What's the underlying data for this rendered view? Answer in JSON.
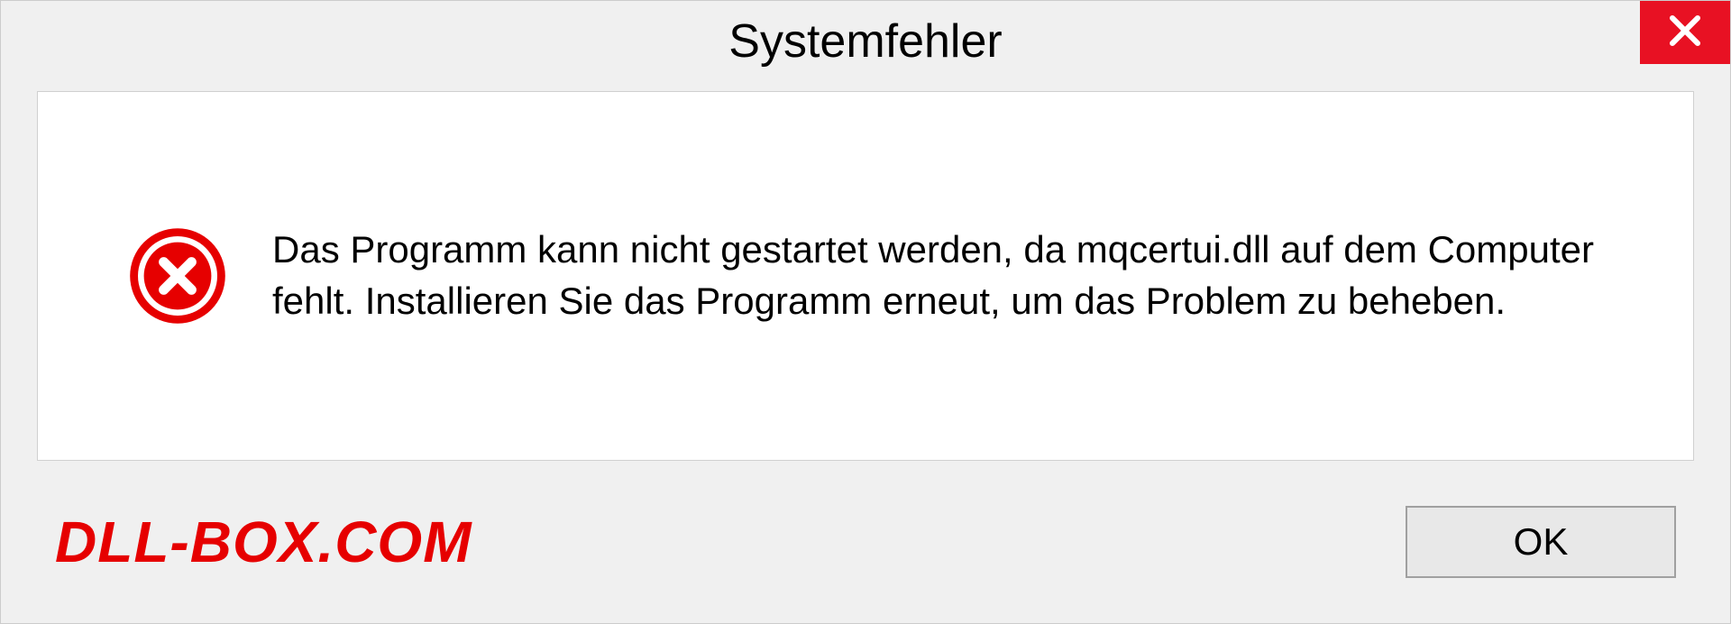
{
  "dialog": {
    "title": "Systemfehler",
    "message": "Das Programm kann nicht gestartet werden, da mqcertui.dll auf dem Computer fehlt. Installieren Sie das Programm erneut, um das Problem zu beheben.",
    "ok_label": "OK"
  },
  "watermark": "DLL-BOX.COM"
}
